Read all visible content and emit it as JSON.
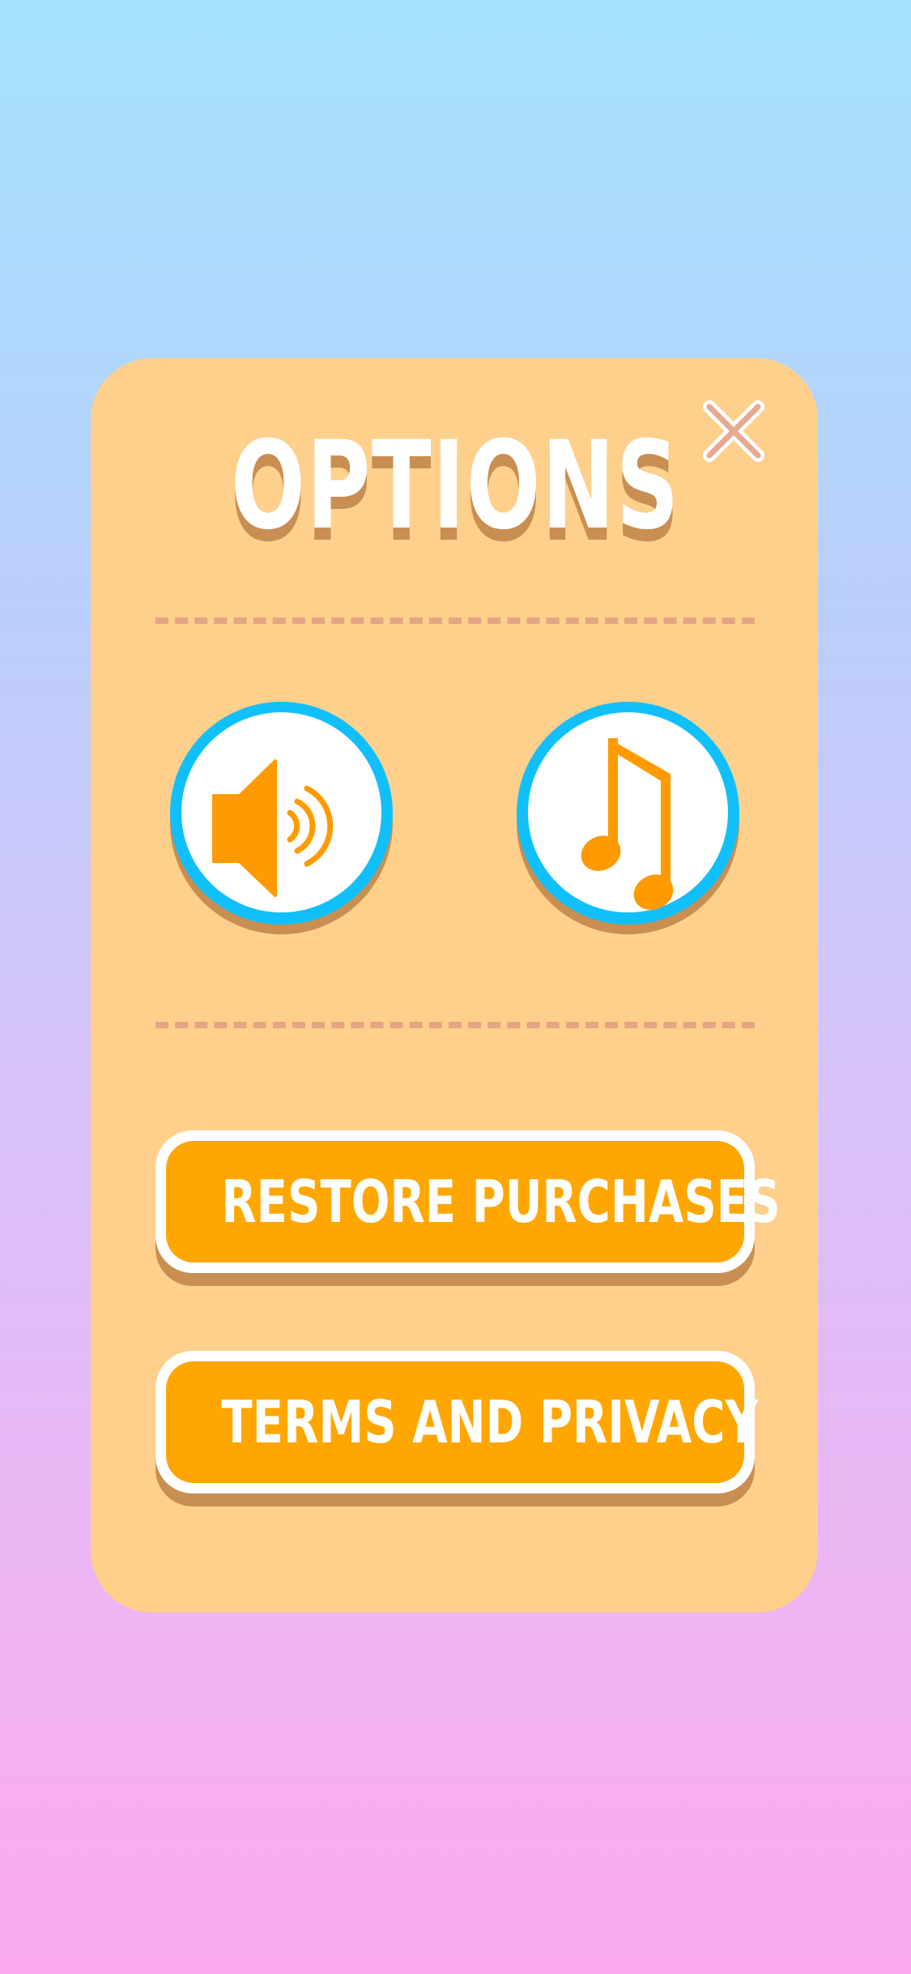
{
  "screen": {
    "title": "OPTIONS",
    "close_icon": "close-icon"
  },
  "toggles": {
    "sound": {
      "icon": "speaker-icon"
    },
    "music": {
      "icon": "music-note-icon"
    }
  },
  "buttons": {
    "restore_label": "RESTORE PURCHASES",
    "terms_label": "TERMS AND PRIVACY"
  },
  "colors": {
    "panel": "#fed08c",
    "accent_orange": "#ffa600",
    "ring_blue": "#11c0fb",
    "shadow_brown": "#c98e52",
    "close_pink": "#e7a891"
  }
}
